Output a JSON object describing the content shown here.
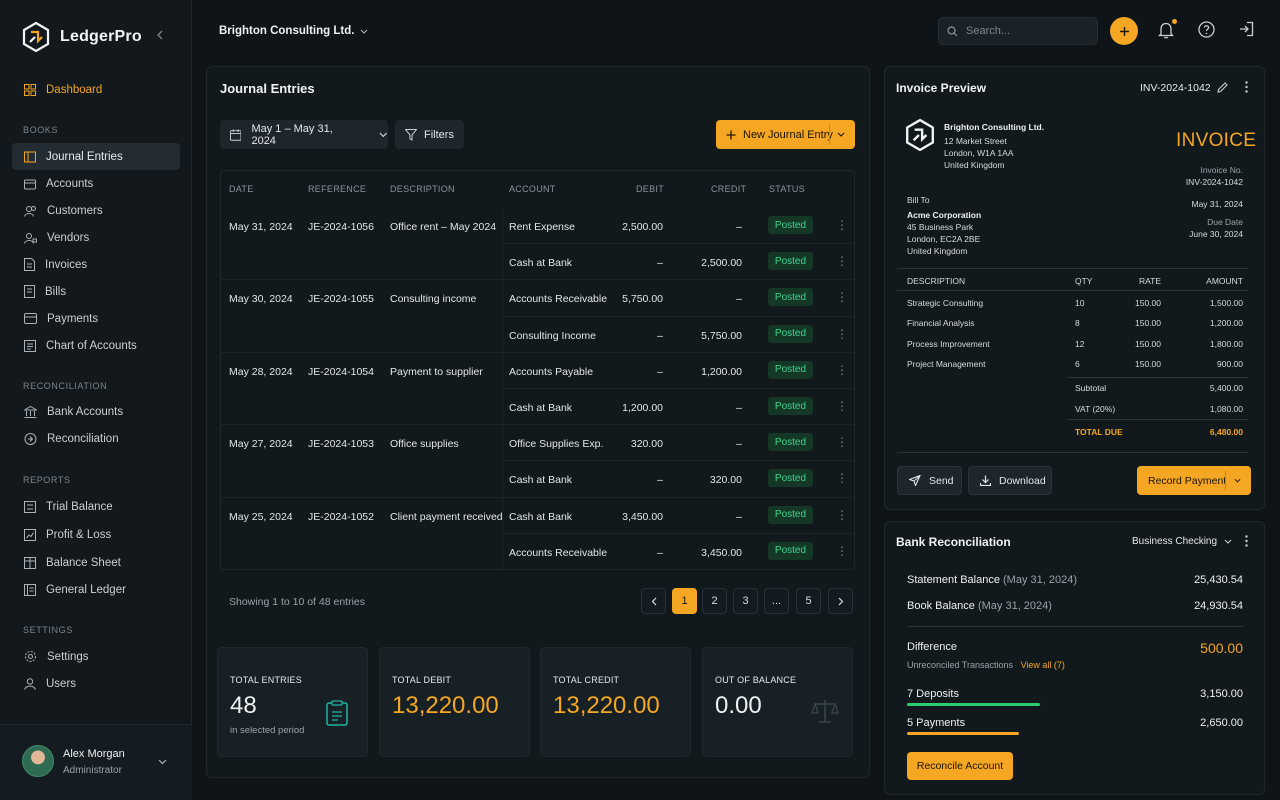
{
  "app": {
    "name": "LedgerPro"
  },
  "sidebar": {
    "dashboard": "Dashboard",
    "sections": {
      "books": "BOOKS",
      "reconciliation": "RECONCILIATION",
      "reports": "REPORTS",
      "settings": "SETTINGS"
    },
    "books": [
      "Journal Entries",
      "Accounts",
      "Customers",
      "Vendors",
      "Invoices",
      "Bills",
      "Payments",
      "Chart of Accounts"
    ],
    "reconciliation": [
      "Bank Accounts",
      "Reconciliation"
    ],
    "reports": [
      "Trial Balance",
      "Profit & Loss",
      "Balance Sheet",
      "General Ledger"
    ],
    "settings": [
      "Settings",
      "Users"
    ],
    "user": {
      "name": "Alex Morgan",
      "role": "Administrator"
    }
  },
  "topbar": {
    "company": "Brighton Consulting Ltd.",
    "search_placeholder": "Search..."
  },
  "journal": {
    "title": "Journal Entries",
    "date_range": "May 1 – May 31, 2024",
    "filters": "Filters",
    "new_entry": "New Journal Entry",
    "columns": [
      "DATE",
      "REFERENCE",
      "DESCRIPTION",
      "ACCOUNT",
      "DEBIT",
      "CREDIT",
      "STATUS"
    ],
    "rows": [
      {
        "date": "May 31, 2024",
        "ref": "JE-2024-1056",
        "desc": "Office rent – May 2024",
        "account": "Rent Expense",
        "debit": "2,500.00",
        "credit": "–",
        "status": "Posted"
      },
      {
        "date": "",
        "ref": "",
        "desc": "",
        "account": "Cash at Bank",
        "debit": "–",
        "credit": "2,500.00",
        "status": "Posted"
      },
      {
        "date": "May 30, 2024",
        "ref": "JE-2024-1055",
        "desc": "Consulting income",
        "account": "Accounts Receivable",
        "debit": "5,750.00",
        "credit": "–",
        "status": "Posted"
      },
      {
        "date": "",
        "ref": "",
        "desc": "",
        "account": "Consulting Income",
        "debit": "–",
        "credit": "5,750.00",
        "status": "Posted"
      },
      {
        "date": "May 28, 2024",
        "ref": "JE-2024-1054",
        "desc": "Payment to supplier",
        "account": "Accounts Payable",
        "debit": "–",
        "credit": "1,200.00",
        "status": "Posted"
      },
      {
        "date": "",
        "ref": "",
        "desc": "",
        "account": "Cash at Bank",
        "debit": "1,200.00",
        "credit": "–",
        "status": "Posted"
      },
      {
        "date": "May 27, 2024",
        "ref": "JE-2024-1053",
        "desc": "Office supplies",
        "account": "Office Supplies Exp.",
        "debit": "320.00",
        "credit": "–",
        "status": "Posted"
      },
      {
        "date": "",
        "ref": "",
        "desc": "",
        "account": "Cash at Bank",
        "debit": "–",
        "credit": "320.00",
        "status": "Posted"
      },
      {
        "date": "May 25, 2024",
        "ref": "JE-2024-1052",
        "desc": "Client payment received",
        "account": "Cash at Bank",
        "debit": "3,450.00",
        "credit": "–",
        "status": "Posted"
      },
      {
        "date": "",
        "ref": "",
        "desc": "",
        "account": "Accounts Receivable",
        "debit": "–",
        "credit": "3,450.00",
        "status": "Posted"
      }
    ],
    "showing": "Showing 1 to 10 of 48 entries",
    "pages": [
      "1",
      "2",
      "3",
      "...",
      "5"
    ],
    "stats": [
      {
        "label": "TOTAL ENTRIES",
        "value": "48",
        "sub": "in selected period"
      },
      {
        "label": "TOTAL DEBIT",
        "value": "13,220.00",
        "sub": ""
      },
      {
        "label": "TOTAL CREDIT",
        "value": "13,220.00",
        "sub": ""
      },
      {
        "label": "OUT OF BALANCE",
        "value": "0.00",
        "sub": ""
      }
    ]
  },
  "invoice": {
    "title": "Invoice Preview",
    "number": "INV-2024-1042",
    "heading": "INVOICE",
    "company": {
      "name": "Brighton Consulting Ltd.",
      "line1": "12 Market Street",
      "line2": "London, W1A 1AA",
      "line3": "United Kingdom"
    },
    "meta": {
      "invoice_no_label": "Invoice No.",
      "invoice_no": "INV-2024-1042",
      "date": "May 31, 2024",
      "due_label": "Due Date",
      "due": "June 30, 2024"
    },
    "bill_to": {
      "label": "Bill To",
      "name": "Acme Corporation",
      "line1": "45 Business Park",
      "line2": "London, EC2A 2BE",
      "line3": "United Kingdom"
    },
    "columns": [
      "DESCRIPTION",
      "QTY",
      "RATE",
      "AMOUNT"
    ],
    "items": [
      {
        "desc": "Strategic Consulting",
        "qty": "10",
        "rate": "150.00",
        "amount": "1,500.00"
      },
      {
        "desc": "Financial Analysis",
        "qty": "8",
        "rate": "150.00",
        "amount": "1,200.00"
      },
      {
        "desc": "Process Improvement",
        "qty": "12",
        "rate": "150.00",
        "amount": "1,800.00"
      },
      {
        "desc": "Project Management",
        "qty": "6",
        "rate": "150.00",
        "amount": "900.00"
      }
    ],
    "subtotal_label": "Subtotal",
    "subtotal": "5,400.00",
    "vat_label": "VAT (20%)",
    "vat": "1,080.00",
    "total_label": "TOTAL DUE",
    "total": "6,480.00",
    "send": "Send",
    "download": "Download",
    "record_payment": "Record Payment"
  },
  "bank": {
    "title": "Bank Reconciliation",
    "account": "Business Checking",
    "statement_label": "Statement Balance",
    "statement_date": "(May 31, 2024)",
    "statement": "25,430.54",
    "book_label": "Book Balance",
    "book_date": "(May 31, 2024)",
    "book": "24,930.54",
    "difference_label": "Difference",
    "difference": "500.00",
    "unreconciled": "Unreconciled Transactions",
    "view_all": "View all (7)",
    "deposits_label": "7 Deposits",
    "deposits": "3,150.00",
    "deposits_progress": 0.5,
    "payments_label": "5 Payments",
    "payments": "2,650.00",
    "payments_progress": 0.42,
    "reconcile": "Reconcile Account"
  },
  "colors": {
    "accent": "#f5a623",
    "posted": "#3dd68c",
    "background": "#0f1418"
  }
}
